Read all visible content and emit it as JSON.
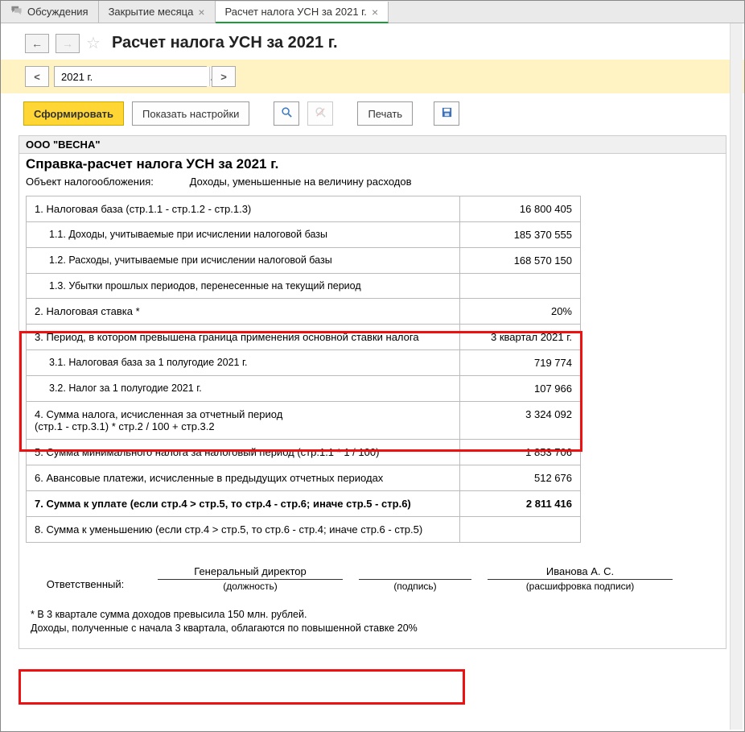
{
  "tabs": {
    "t0": "Обсуждения",
    "t1": "Закрытие месяца",
    "t2": "Расчет налога УСН за 2021 г."
  },
  "page_title": "Расчет налога УСН за 2021 г.",
  "period": {
    "value": "2021 г."
  },
  "toolbar": {
    "form": "Сформировать",
    "settings": "Показать настройки",
    "print": "Печать"
  },
  "report": {
    "org": "ООО \"ВЕСНА\"",
    "title": "Справка-расчет налога УСН за 2021 г.",
    "tax_object_label": "Объект налогообложения:",
    "tax_object_value": "Доходы, уменьшенные на величину расходов",
    "rows": {
      "r1": {
        "label": "1. Налоговая база (стр.1.1 - стр.1.2 - стр.1.3)",
        "value": "16 800 405"
      },
      "r11": {
        "label": "1.1. Доходы, учитываемые при исчислении налоговой базы",
        "value": "185 370 555"
      },
      "r12": {
        "label": "1.2. Расходы, учитываемые при исчислении налоговой базы",
        "value": "168 570 150"
      },
      "r13": {
        "label": "1.3. Убытки прошлых периодов, перенесенные на текущий период",
        "value": ""
      },
      "r2": {
        "label": "2. Налоговая ставка *",
        "value": "20%"
      },
      "r3": {
        "label": "3. Период, в котором превышена граница применения основной ставки налога",
        "value": "3 квартал 2021 г."
      },
      "r31": {
        "label": "3.1. Налоговая база за 1 полугодие 2021 г.",
        "value": "719 774"
      },
      "r32": {
        "label": "3.2. Налог за 1 полугодие 2021 г.",
        "value": "107 966"
      },
      "r4": {
        "label": "4. Сумма налога, исчисленная за отчетный период\n(стр.1 - стр.3.1) * стр.2 / 100 + стр.3.2",
        "value": "3 324 092"
      },
      "r5": {
        "label": "5. Сумма минимального налога за налоговый период (стр.1.1 * 1 / 100)",
        "value": "1 853 706"
      },
      "r6": {
        "label": "6. Авансовые платежи, исчисленные в предыдущих отчетных периодах",
        "value": "512 676"
      },
      "r7": {
        "label": "7. Сумма к уплате (если стр.4 > стр.5, то стр.4 - стр.6; иначе стр.5 - стр.6)",
        "value": "2 811 416"
      },
      "r8": {
        "label": "8. Сумма к уменьшению (если стр.4 > стр.5, то стр.6 - стр.4; иначе стр.6 - стр.5)",
        "value": ""
      }
    },
    "sign": {
      "resp_label": "Ответственный:",
      "position_value": "Генеральный директор",
      "position_caption": "(должность)",
      "sign_caption": "(подпись)",
      "name_value": "Иванова А. С.",
      "name_caption": "(расшифровка подписи)"
    },
    "footnote_l1": "* В 3 квартале сумма доходов превысила 150 млн. рублей.",
    "footnote_l2": "Доходы, полученные с начала 3 квартала, облагаются по повышенной ставке 20%"
  }
}
